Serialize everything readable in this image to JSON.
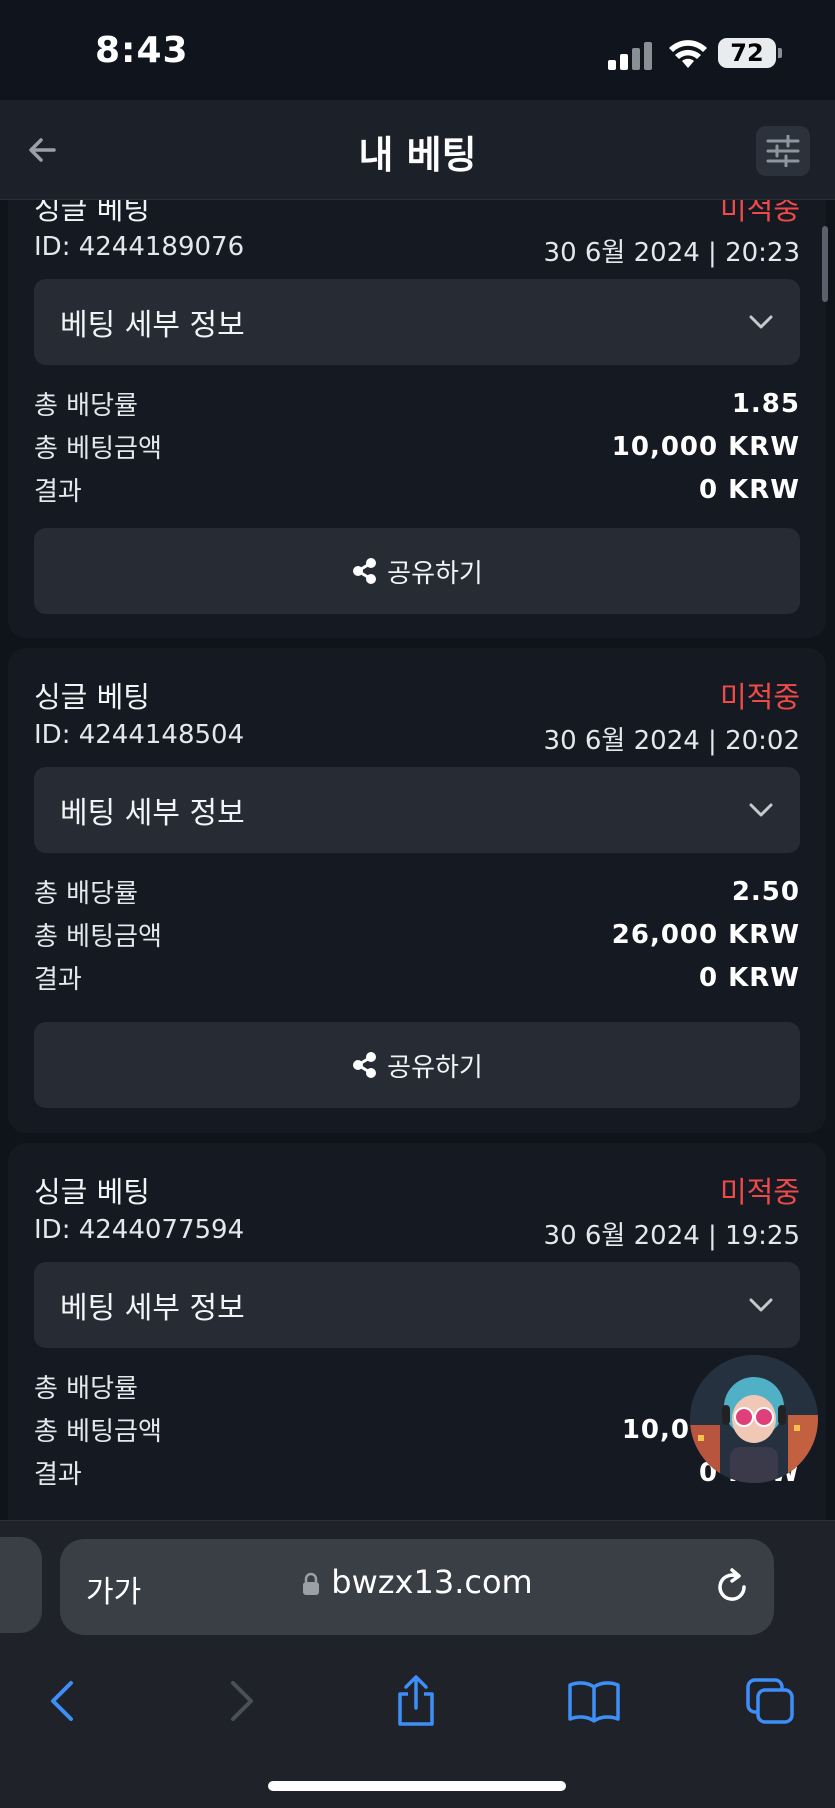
{
  "status_bar": {
    "time": "8:43",
    "battery": "72"
  },
  "header": {
    "title": "내 베팅"
  },
  "bets": [
    {
      "type": "싱글 베팅",
      "status": "미적중",
      "id": "ID: 4244189076",
      "datetime": "30 6월 2024 | 20:23",
      "details_label": "베팅 세부 정보",
      "stats": [
        {
          "label": "총 배당률",
          "value": "1.85"
        },
        {
          "label": "총 베팅금액",
          "value": "10,000 KRW"
        },
        {
          "label": "결과",
          "value": "0 KRW"
        }
      ],
      "share_label": "공유하기"
    },
    {
      "type": "싱글 베팅",
      "status": "미적중",
      "id": "ID: 4244148504",
      "datetime": "30 6월 2024 | 20:02",
      "details_label": "베팅 세부 정보",
      "stats": [
        {
          "label": "총 배당률",
          "value": "2.50"
        },
        {
          "label": "총 베팅금액",
          "value": "26,000 KRW"
        },
        {
          "label": "결과",
          "value": "0 KRW"
        }
      ],
      "share_label": "공유하기"
    },
    {
      "type": "싱글 베팅",
      "status": "미적중",
      "id": "ID: 4244077594",
      "datetime": "30 6월 2024 | 19:25",
      "details_label": "베팅 세부 정보",
      "stats": [
        {
          "label": "총 배당률",
          "value": ""
        },
        {
          "label": "총 베팅금액",
          "value": "10,0"
        },
        {
          "label": "결과",
          "value": "0 KRW"
        }
      ],
      "share_label": "공유하기"
    }
  ],
  "browser": {
    "aa_label": "가가",
    "url": "bwzx13.com"
  },
  "colors": {
    "accent_red": "#ef4a4a",
    "safari_blue": "#3d8ef7",
    "card_bg": "#151a22"
  }
}
